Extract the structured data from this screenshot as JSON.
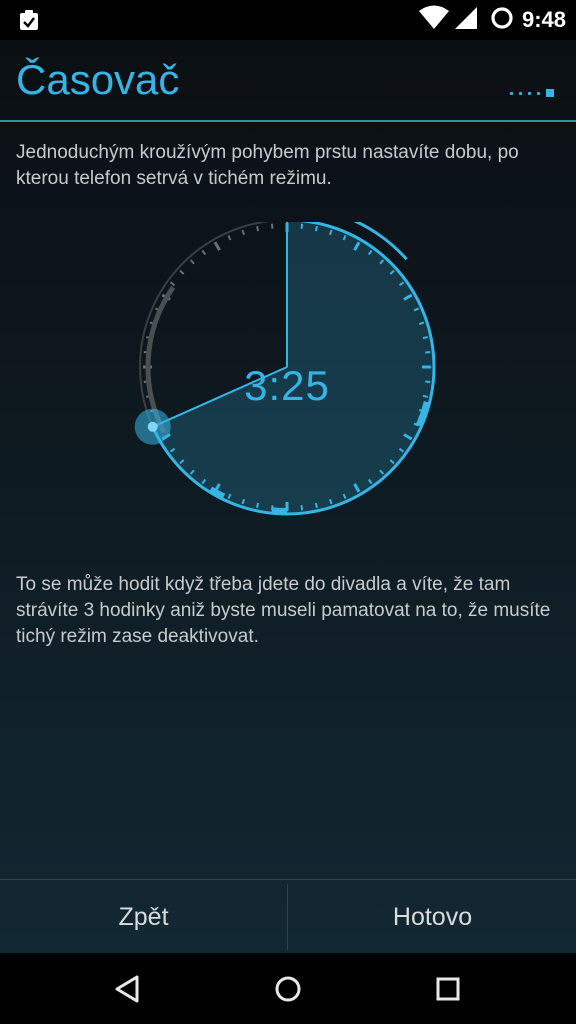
{
  "status_bar": {
    "time": "9:48",
    "icons": [
      "clipboard-check-icon",
      "wifi-icon",
      "cell-signal-icon",
      "circle-icon"
    ]
  },
  "header": {
    "title": "Časovač",
    "page_count": 5,
    "active_page": 5
  },
  "intro_text": "Jednoduchým kroužívým pohybem prstu nastavíte dobu, po kterou telefon setrvá v tichém režimu.",
  "dial": {
    "time": "3:25",
    "hours_set": 3.4167,
    "max_hours": 5,
    "accent_color": "#35b5e5"
  },
  "outro_text": "To se může hodit když třeba jdete do divadla a víte, že tam strávíte 3 hodinky aniž byste museli pamatovat na to, že musíte tichý režim zase deaktivovat.",
  "buttons": {
    "back": "Zpět",
    "done": "Hotovo"
  },
  "nav": {
    "icons": [
      "back-triangle-icon",
      "home-circle-icon",
      "recents-square-icon"
    ]
  }
}
